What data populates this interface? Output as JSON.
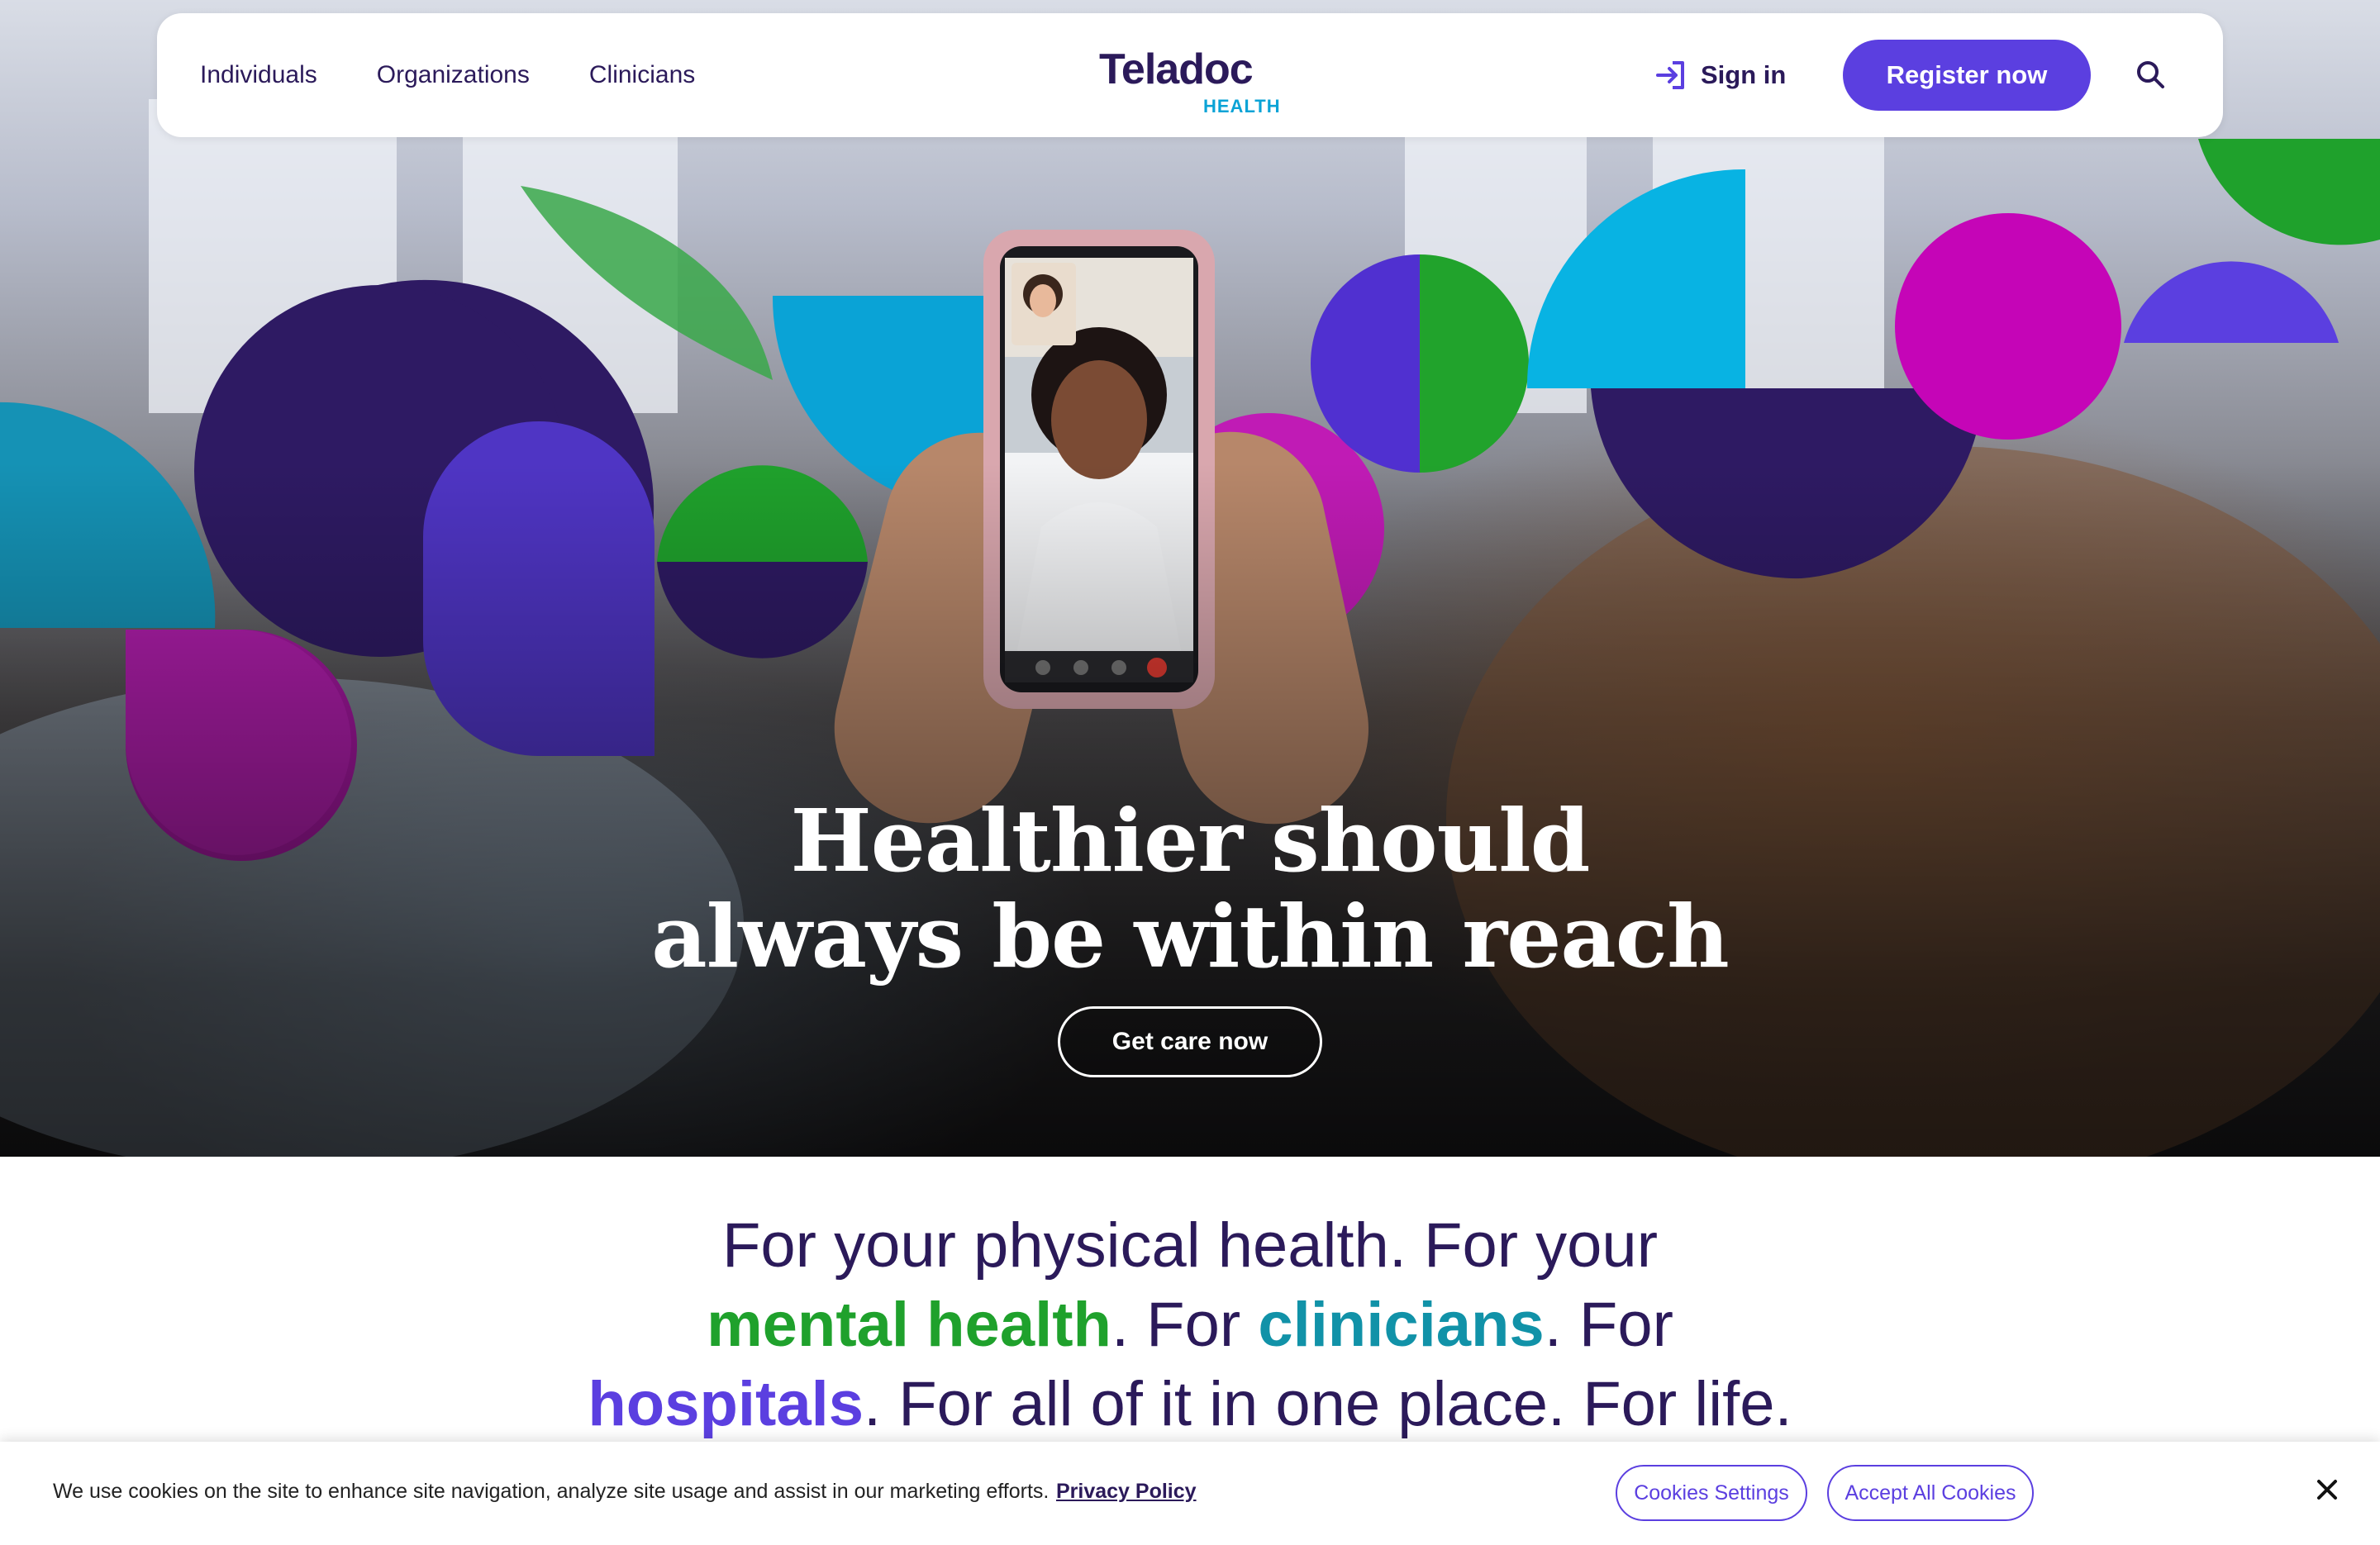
{
  "nav": {
    "links": [
      "Individuals",
      "Organizations",
      "Clinicians"
    ],
    "logo": {
      "main": "Teladoc",
      "sub": "HEALTH"
    },
    "signin_label": "Sign in",
    "register_label": "Register now",
    "search_icon": "search-icon"
  },
  "hero": {
    "title_line1": "Healthier should",
    "title_line2": "always be within reach",
    "cta_label": "Get care now"
  },
  "tagline": {
    "p1": "For your physical health. For your",
    "mental": "mental health",
    "p2": ". For ",
    "clinicians": "clinicians",
    "p3": ". For",
    "hospitals": "hospitals",
    "p4": ". For all of it in one place. For life."
  },
  "cookie": {
    "text": "We use cookies on the site to enhance site navigation, analyze site usage and assist in our marketing efforts.",
    "privacy_label": "Privacy Policy",
    "settings_label": "Cookies Settings",
    "accept_label": "Accept All Cookies",
    "close_icon": "close-icon"
  },
  "colors": {
    "brand_purple": "#5b3fe0",
    "dark_purple": "#2b1a5a",
    "green": "#1fa12c",
    "teal": "#1192a8",
    "magenta": "#c020b8",
    "cyan": "#08b3e3"
  }
}
